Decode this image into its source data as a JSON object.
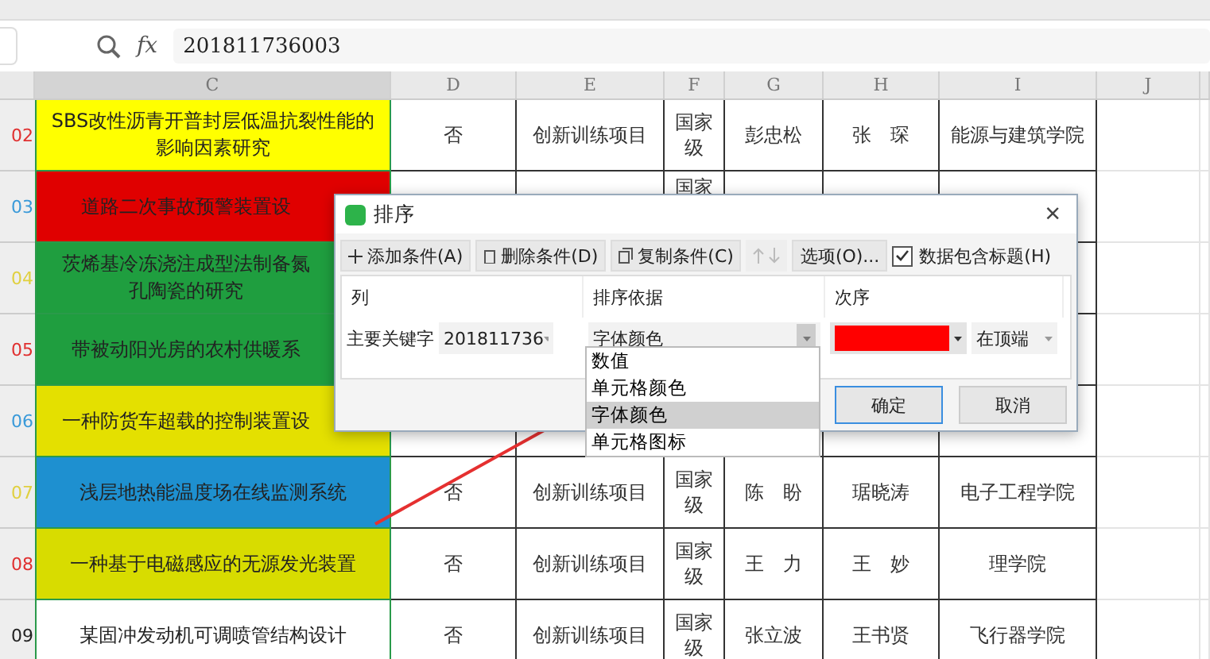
{
  "formula_bar": {
    "fx": "fx",
    "value": "201811736003"
  },
  "columns": [
    {
      "label": "C",
      "selected": true
    },
    {
      "label": "D",
      "selected": false
    },
    {
      "label": "E",
      "selected": false
    },
    {
      "label": "F",
      "selected": false
    },
    {
      "label": "G",
      "selected": false
    },
    {
      "label": "H",
      "selected": false
    },
    {
      "label": "I",
      "selected": false
    },
    {
      "label": "J",
      "selected": false
    }
  ],
  "rows": [
    {
      "id": {
        "text": "02",
        "color": "#e03030"
      },
      "color": "#ffff00",
      "cut": false,
      "cells": [
        "SBS改性沥青开普封层低温抗裂性能的影响因素研究",
        "否",
        "创新训练项目",
        "国家级",
        "彭忠松",
        "张　琛",
        "能源与建筑学院"
      ]
    },
    {
      "id": {
        "text": "03",
        "color": "#3a9ad9"
      },
      "color": "#e00000",
      "cut": true,
      "cells": [
        "道路二次事故预警装置设",
        null,
        null,
        "国家",
        null,
        null,
        null
      ]
    },
    {
      "id": {
        "text": "04",
        "color": "#e0d040"
      },
      "color": "#1f9e3f",
      "cut": true,
      "cells": [
        "茨烯基冷冻浇注成型法制备氮孔陶瓷的研究",
        null,
        null,
        null,
        null,
        null,
        null
      ]
    },
    {
      "id": {
        "text": "05",
        "color": "#e03030"
      },
      "color": "#1f9e3f",
      "cut": true,
      "cells": [
        "带被动阳光房的农村供暖系",
        null,
        null,
        null,
        null,
        null,
        null
      ]
    },
    {
      "id": {
        "text": "06",
        "color": "#3a9ad9"
      },
      "color": "#e4e000",
      "cut": true,
      "cells": [
        "一种防货车超载的控制装置设",
        null,
        null,
        null,
        null,
        null,
        null
      ]
    },
    {
      "id": {
        "text": "07",
        "color": "#e0d040"
      },
      "color": "#1e90d0",
      "cut": false,
      "cells": [
        "浅层地热能温度场在线监测系统",
        "否",
        "创新训练项目",
        "国家级",
        "陈　盼",
        "琚晓涛",
        "电子工程学院"
      ]
    },
    {
      "id": {
        "text": "08",
        "color": "#e03030"
      },
      "color": "#d8dc00",
      "cut": false,
      "cells": [
        "一种基于电磁感应的无源发光装置",
        "否",
        "创新训练项目",
        "国家级",
        "王　力",
        "王　妙",
        "理学院"
      ]
    },
    {
      "id": {
        "text": "09",
        "color": "#222222"
      },
      "color": "#ffffff",
      "cut": false,
      "cells": [
        "某固冲发动机可调喷管结构设计",
        "否",
        "创新训练项目",
        "国家级",
        "张立波",
        "王书贤",
        "飞行器学院"
      ]
    }
  ],
  "dialog": {
    "title": "排序",
    "close": "×",
    "toolbar": [
      {
        "kind": "button",
        "label": "添加条件(A)"
      },
      {
        "kind": "button",
        "label": "删除条件(D)"
      },
      {
        "kind": "button",
        "label": "复制条件(C)"
      },
      {
        "kind": "arrows",
        "disabled": true
      },
      {
        "kind": "button",
        "label": "选项(O)..."
      },
      {
        "kind": "checkbox",
        "label": "数据包含标题(H)",
        "checked": true
      }
    ],
    "headers": [
      "列",
      "排序依据",
      "次序"
    ],
    "condition": {
      "label": "主要关键字",
      "column": "201811736",
      "basis": "字体颜色",
      "color": "#ff0000",
      "position": "在顶端"
    },
    "basis_options": [
      {
        "label": "数值",
        "selected": false
      },
      {
        "label": "单元格颜色",
        "selected": false
      },
      {
        "label": "字体颜色",
        "selected": true
      },
      {
        "label": "单元格图标",
        "selected": false
      }
    ],
    "buttons": [
      {
        "label": "确定",
        "primary": true
      },
      {
        "label": "取消",
        "primary": false
      }
    ]
  }
}
